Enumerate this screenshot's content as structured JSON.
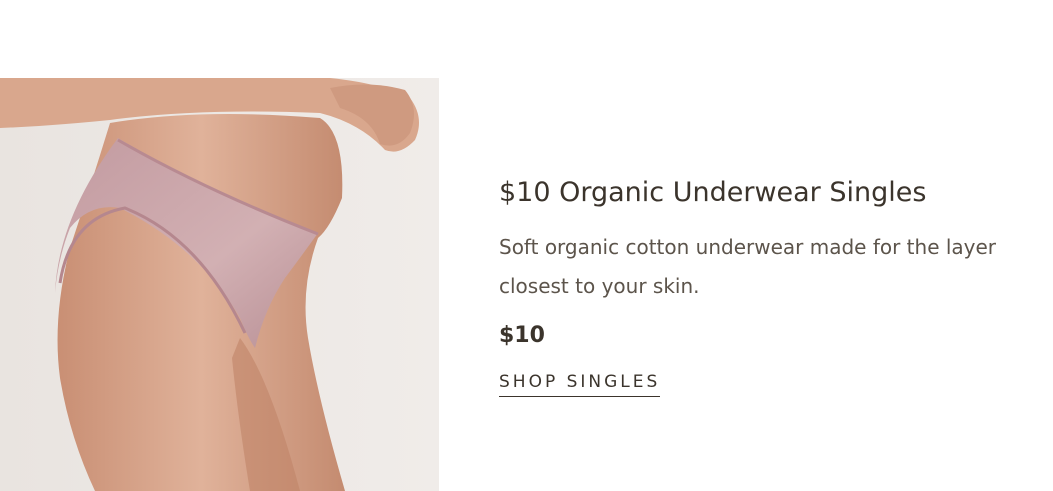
{
  "product": {
    "title": "$10 Organic Underwear Singles",
    "description": "Soft organic cotton underwear made for the layer closest to your skin.",
    "price": "$10",
    "cta_label": "SHOP SINGLES",
    "image_alt": "Model wearing mauve organic cotton bikini underwear",
    "underwear_color": "#c9a3a6",
    "skin_color": "#dcae93",
    "background_color": "#ebe6e2"
  }
}
